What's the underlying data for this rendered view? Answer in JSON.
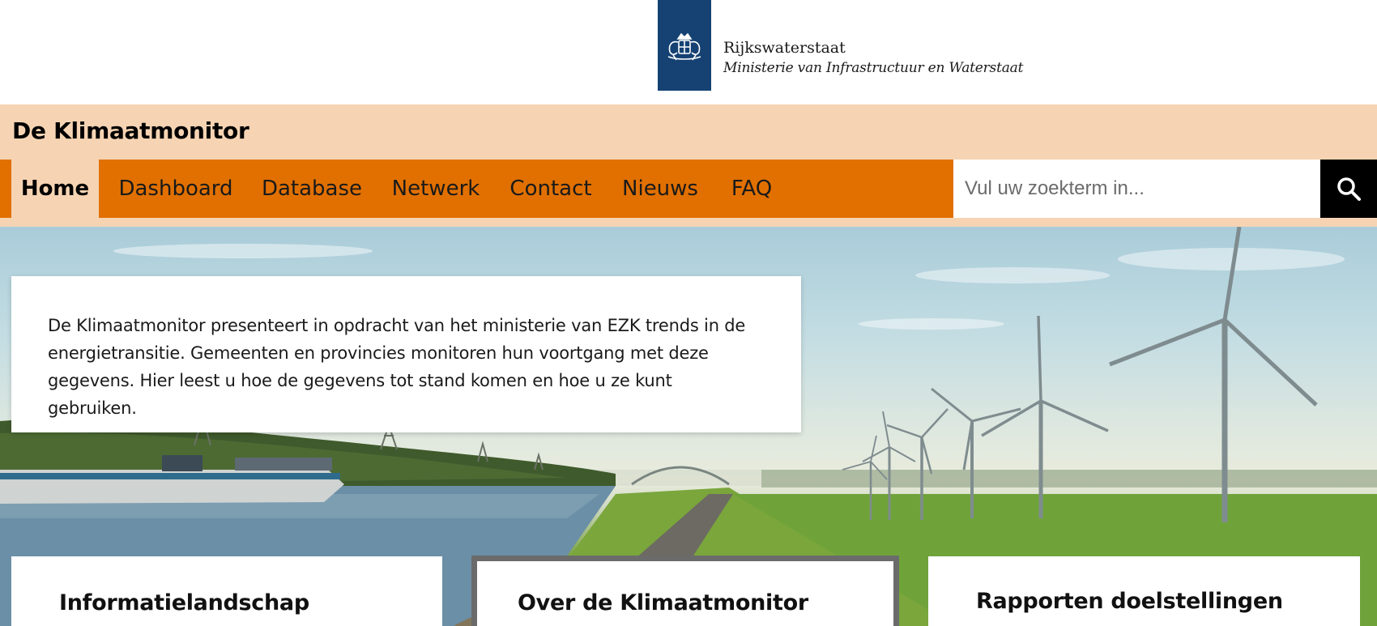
{
  "logo": {
    "name": "Rijkswaterstaat",
    "subtitle": "Ministerie van Infrastructuur en Waterstaat",
    "emblem_icon": "coat-of-arms-icon"
  },
  "site": {
    "title": "De Klimaatmonitor"
  },
  "nav": {
    "items": [
      {
        "label": "Home",
        "active": true
      },
      {
        "label": "Dashboard",
        "active": false
      },
      {
        "label": "Database",
        "active": false
      },
      {
        "label": "Netwerk",
        "active": false
      },
      {
        "label": "Contact",
        "active": false
      },
      {
        "label": "Nieuws",
        "active": false
      },
      {
        "label": "FAQ",
        "active": false
      }
    ]
  },
  "search": {
    "placeholder": "Vul uw zoekterm in...",
    "value": "",
    "button_icon": "search-icon"
  },
  "hero": {
    "intro": "De Klimaatmonitor presenteert in opdracht van het ministerie van EZK trends in de energietransitie. Gemeenten en provincies monitoren hun voortgang met deze gegevens. Hier leest u hoe de gegevens tot stand komen en hoe u ze kunt gebruiken."
  },
  "tiles": [
    {
      "title": "Informatielandschap"
    },
    {
      "title": "Over de Klimaatmonitor"
    },
    {
      "title": "Rapporten doelstellingen"
    }
  ],
  "colors": {
    "accent": "#e17000",
    "band": "#f6d4b3",
    "brand_blue": "#154273"
  }
}
